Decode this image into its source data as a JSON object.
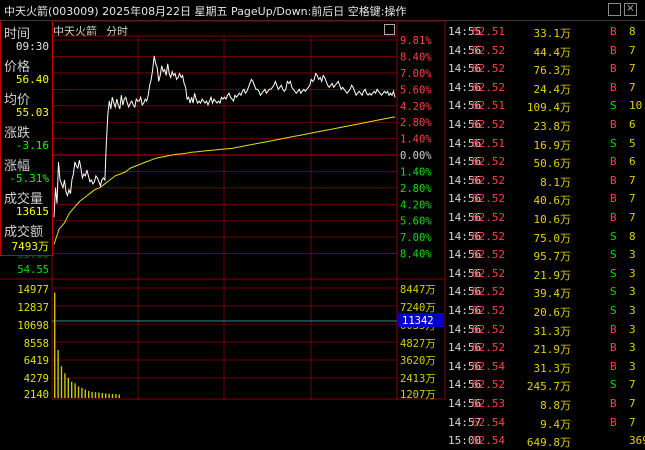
{
  "window": {
    "title": "中天火箭(003009)  2025年08月22日 星期五 PageUp/Down:前后日 空格键:操作",
    "close_glyph": "×"
  },
  "chart_header": {
    "name": "中天火箭",
    "mode": "分时"
  },
  "info_panel": {
    "items": [
      {
        "label": "时间",
        "value": "09:30",
        "color": "#e0e0e0"
      },
      {
        "label": "价格",
        "value": "56.40",
        "color": "#ffff00"
      },
      {
        "label": "均价",
        "value": "55.03",
        "color": "#ffff00"
      },
      {
        "label": "涨跌",
        "value": "-3.16",
        "color": "#00ff00"
      },
      {
        "label": "涨幅",
        "value": "-5.31%",
        "color": "#00ff00"
      },
      {
        "label": "成交量",
        "value": "13615",
        "color": "#ffff00"
      },
      {
        "label": "成交额",
        "value": "7493万",
        "color": "#ffff00"
      }
    ]
  },
  "left_axis_labels": [
    "53.00",
    "54.55",
    "14977",
    "12837",
    "10698",
    "8558",
    "6419",
    "4279",
    "2140"
  ],
  "right_axis_pct": [
    "9.81%",
    "8.40%",
    "7.00%",
    "5.60%",
    "4.20%",
    "2.80%",
    "1.40%",
    "0.00%",
    "1.40%",
    "2.80%",
    "4.20%",
    "5.60%",
    "7.00%",
    "8.40%"
  ],
  "right_axis_vol": [
    "8447万",
    "7240万",
    "6033万",
    "4827万",
    "3620万",
    "2413万",
    "1207万"
  ],
  "volume_marker": "11342",
  "colors": {
    "up": "#ff4040",
    "down": "#00e000",
    "grid": "#8b0000",
    "price": "#ffffff",
    "avg": "#e0e000",
    "volume": "#c8c800"
  },
  "chart_data": {
    "type": "line",
    "prev_close": 59.56,
    "series": [
      {
        "values": [
          56.4,
          57.9,
          57.1,
          59.2,
          58.3,
          58.1,
          57.9,
          58.3,
          57.7,
          57.5,
          57.8,
          57.6,
          58.3,
          58.6,
          59.2,
          59.0,
          58.9,
          59.3,
          58.9,
          58.4,
          58.6,
          58.5,
          58.8,
          58.5,
          58.2,
          58.3,
          58.1,
          58.2,
          58.5,
          58.4,
          58.2,
          58.0,
          58.3,
          58.4,
          58.3,
          60.1,
          61.6,
          62.3,
          61.9,
          62.5,
          62.2,
          62.0,
          62.4,
          62.1,
          61.9,
          62.6,
          62.1,
          62.4,
          62.5,
          62.2,
          62.0,
          62.2,
          62.3,
          62.1,
          62.0,
          62.4,
          62.3,
          62.3,
          62.5,
          62.1,
          62.2,
          62.4,
          62.3,
          62.6,
          63.1,
          63.4,
          63.9,
          64.6,
          64.2,
          64.0,
          63.3,
          63.6,
          64.1,
          63.8,
          63.9,
          63.6,
          64.2,
          63.7,
          63.5,
          63.8,
          63.6,
          63.7,
          63.4,
          63.5,
          63.7,
          63.5,
          63.6,
          63.2,
          63.0,
          62.4,
          62.5,
          62.2,
          62.5,
          62.2,
          62.7,
          62.4,
          62.2,
          62.3,
          62.2,
          62.4,
          62.3,
          62.2,
          62.3,
          62.1,
          62.3,
          62.5,
          62.2,
          62.4,
          62.3,
          62.2,
          62.3,
          62.2,
          62.5,
          62.4,
          62.5,
          62.4,
          62.6,
          62.7,
          62.5,
          62.4,
          62.3,
          62.6,
          62.5,
          62.6,
          62.7,
          62.6,
          62.8,
          62.9,
          62.7,
          62.8,
          63.0,
          63.2,
          63.4,
          63.3,
          63.1,
          62.9,
          62.9,
          62.8,
          62.6,
          62.7,
          62.8,
          62.9,
          62.7,
          62.8,
          62.9,
          62.9,
          63.0,
          63.1,
          63.3,
          63.1,
          62.9,
          63.0,
          63.1,
          62.9,
          62.8,
          62.9,
          63.3,
          63.2,
          63.3,
          63.0,
          62.9,
          62.8,
          62.7,
          62.8,
          62.9,
          62.7,
          62.8,
          62.9,
          62.8,
          62.9,
          63.0,
          63.1,
          63.4,
          63.3,
          63.4,
          63.7,
          63.6,
          63.4,
          63.5,
          63.3,
          63.6,
          63.5,
          63.3,
          63.1,
          63.0,
          63.1,
          63.2,
          63.0,
          63.1,
          63.2,
          63.3,
          63.1,
          62.9,
          63.0,
          62.9,
          62.8,
          62.7,
          62.8,
          62.9,
          63.1,
          63.0,
          62.8,
          62.6,
          62.7,
          62.8,
          62.7,
          62.6,
          62.8,
          62.9,
          62.7,
          62.6,
          62.7,
          62.6,
          62.7,
          62.8,
          62.7,
          62.9,
          62.8,
          62.7,
          62.6,
          62.7,
          62.8,
          62.7,
          62.8,
          62.6,
          62.7,
          62.6,
          62.8,
          62.5
        ]
      },
      {
        "values": [
          55.03,
          55.8,
          56.1,
          56.6,
          56.9,
          57.2,
          57.4,
          57.6,
          57.8,
          57.9,
          58.1,
          58.3,
          58.5,
          58.6,
          58.7,
          58.9,
          59.0,
          59.1,
          59.2,
          59.3,
          59.4,
          59.45,
          59.5,
          59.55,
          59.6,
          59.62,
          59.65,
          59.7,
          59.72,
          59.75,
          59.78,
          59.8,
          59.83,
          59.85,
          59.88,
          59.9,
          59.95,
          60.0,
          60.05,
          60.1,
          60.15,
          60.2,
          60.25,
          60.3,
          60.35,
          60.4,
          60.45,
          60.5,
          60.55,
          60.6,
          60.65,
          60.7,
          60.75,
          60.8,
          60.85,
          60.9,
          60.95,
          61.0,
          61.05,
          61.1,
          61.15,
          61.2,
          61.25,
          61.3,
          61.35,
          61.4,
          61.45,
          61.5
        ]
      }
    ],
    "pct_ticks": [
      9.81,
      8.4,
      7.0,
      5.6,
      4.2,
      2.8,
      1.4,
      0.0,
      -1.4,
      -2.8,
      -4.2,
      -5.6,
      -7.0,
      -8.4
    ],
    "volume": {
      "max": 14977,
      "values": [
        13615,
        6200,
        4100,
        3200,
        2600,
        2100,
        1900,
        1500,
        1300,
        1100,
        900,
        800,
        760,
        720,
        650,
        600,
        560,
        520,
        500,
        450
      ]
    }
  },
  "trades": [
    {
      "time": "14:55",
      "price": "62.51",
      "vol": "33.1万",
      "side": "B",
      "num": "8"
    },
    {
      "time": "14:56",
      "price": "62.52",
      "vol": "44.4万",
      "side": "B",
      "num": "7"
    },
    {
      "time": "14:56",
      "price": "62.52",
      "vol": "76.3万",
      "side": "B",
      "num": "7"
    },
    {
      "time": "14:56",
      "price": "62.52",
      "vol": "24.4万",
      "side": "B",
      "num": "7"
    },
    {
      "time": "14:56",
      "price": "62.51",
      "vol": "109.4万",
      "side": "S",
      "num": "10"
    },
    {
      "time": "14:56",
      "price": "62.52",
      "vol": "23.8万",
      "side": "B",
      "num": "6"
    },
    {
      "time": "14:56",
      "price": "62.51",
      "vol": "16.9万",
      "side": "S",
      "num": "5"
    },
    {
      "time": "14:56",
      "price": "62.52",
      "vol": "50.6万",
      "side": "B",
      "num": "6"
    },
    {
      "time": "14:56",
      "price": "62.52",
      "vol": "8.1万",
      "side": "B",
      "num": "7"
    },
    {
      "time": "14:56",
      "price": "62.52",
      "vol": "40.6万",
      "side": "B",
      "num": "7"
    },
    {
      "time": "14:56",
      "price": "62.52",
      "vol": "10.6万",
      "side": "B",
      "num": "7"
    },
    {
      "time": "14:56",
      "price": "62.52",
      "vol": "75.0万",
      "side": "S",
      "num": "8"
    },
    {
      "time": "14:56",
      "price": "62.52",
      "vol": "95.7万",
      "side": "S",
      "num": "3"
    },
    {
      "time": "14:56",
      "price": "62.52",
      "vol": "21.9万",
      "side": "S",
      "num": "3"
    },
    {
      "time": "14:56",
      "price": "62.52",
      "vol": "39.4万",
      "side": "S",
      "num": "3"
    },
    {
      "time": "14:56",
      "price": "62.52",
      "vol": "20.6万",
      "side": "S",
      "num": "3"
    },
    {
      "time": "14:56",
      "price": "62.52",
      "vol": "31.3万",
      "side": "B",
      "num": "3"
    },
    {
      "time": "14:56",
      "price": "62.52",
      "vol": "21.9万",
      "side": "B",
      "num": "3"
    },
    {
      "time": "14:56",
      "price": "62.54",
      "vol": "31.3万",
      "side": "B",
      "num": "3"
    },
    {
      "time": "14:56",
      "price": "62.52",
      "vol": "245.7万",
      "side": "S",
      "num": "7"
    },
    {
      "time": "14:56",
      "price": "62.53",
      "vol": "8.8万",
      "side": "B",
      "num": "7"
    },
    {
      "time": "14:57",
      "price": "62.54",
      "vol": "9.4万",
      "side": "B",
      "num": "7"
    },
    {
      "time": "15:00",
      "price": "62.54",
      "vol": "649.8万",
      "side": "",
      "num": "369"
    }
  ]
}
